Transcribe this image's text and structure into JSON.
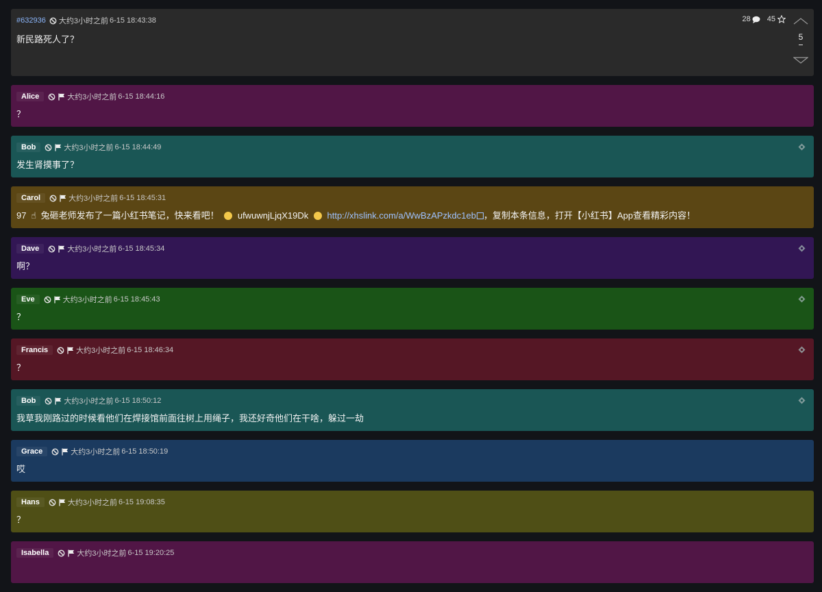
{
  "op": {
    "post_id": "#632936",
    "relative_time": "大约3小时之前",
    "datetime": "6-15 18:43:38",
    "content": "新民路死人了？",
    "reply_count": "28",
    "star_count": "45",
    "vote_count": "5"
  },
  "replies": [
    {
      "name": "Alice",
      "relative_time": "大约3小时之前",
      "datetime": "6-15 18:44:16",
      "content": "？",
      "color": "#511646",
      "pinned": false
    },
    {
      "name": "Bob",
      "relative_time": "大约3小时之前",
      "datetime": "6-15 18:44:49",
      "content": "发生肾摸事了？",
      "color": "#1a5655",
      "pinned": true
    },
    {
      "name": "Carol",
      "relative_time": "大约3小时之前",
      "datetime": "6-15 18:45:31",
      "content_prefix": "97",
      "content_text": "兔砸老师发布了一篇小红书笔记，快来看吧！",
      "content_code": "ufwuwnjLjqX19Dk",
      "content_link": "http://xhslink.com/a/WwBzAPzkdc1eb",
      "content_suffix": "，复制本条信息，打开【小红书】App查看精彩内容！",
      "color": "#5b4614",
      "pinned": false
    },
    {
      "name": "Dave",
      "relative_time": "大约3小时之前",
      "datetime": "6-15 18:45:34",
      "content": "啊？",
      "color": "#321654",
      "pinned": true
    },
    {
      "name": "Eve",
      "relative_time": "大约3小时之前",
      "datetime": "6-15 18:45:43",
      "content": "？",
      "color": "#1a5417",
      "pinned": true
    },
    {
      "name": "Francis",
      "relative_time": "大约3小时之前",
      "datetime": "6-15 18:46:34",
      "content": "？",
      "color": "#551725",
      "pinned": true
    },
    {
      "name": "Bob",
      "relative_time": "大约3小时之前",
      "datetime": "6-15 18:50:12",
      "content": "我草我刚路过的时候看他们在焊接馆前面往树上用绳子，我还好奇他们在干啥，躲过一劫",
      "color": "#1a5655",
      "pinned": true
    },
    {
      "name": "Grace",
      "relative_time": "大约3小时之前",
      "datetime": "6-15 18:50:19",
      "content": "哎",
      "color": "#1b3a5f",
      "pinned": false
    },
    {
      "name": "Hans",
      "relative_time": "大约3小时之前",
      "datetime": "6-15 19:08:35",
      "content": "？",
      "color": "#4f4f16",
      "pinned": false
    },
    {
      "name": "Isabella",
      "relative_time": "大约3小时之前",
      "datetime": "6-15 19:20:25",
      "content": "",
      "color": "#511646",
      "pinned": false
    }
  ],
  "icons": {
    "ban": "ban-icon",
    "flag": "flag-icon",
    "comment": "comment-icon",
    "star": "star-icon",
    "pin": "pin-icon",
    "upvote": "upvote-arrow-icon",
    "downvote": "downvote-arrow-icon"
  }
}
